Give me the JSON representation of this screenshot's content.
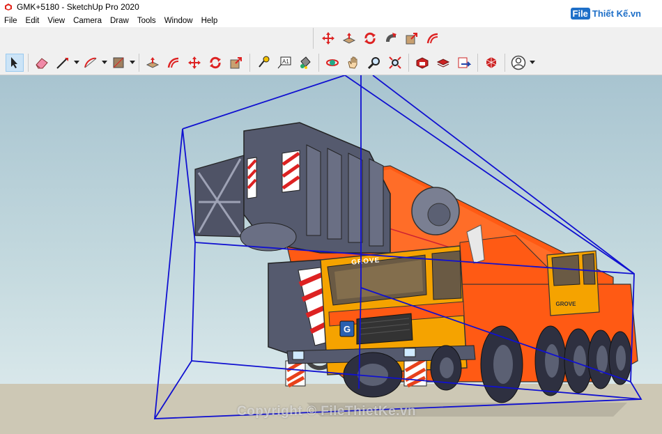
{
  "window": {
    "title": "GMK+5180 - SketchUp Pro 2020"
  },
  "menu": [
    "File",
    "Edit",
    "View",
    "Camera",
    "Draw",
    "Tools",
    "Window",
    "Help"
  ],
  "brand": {
    "prefix": "File",
    "rest": "Thiết Kế.vn"
  },
  "model": {
    "brand_label": "GROVE",
    "badge_letter": "G"
  },
  "watermark": "Copyright © FileThietKe.vn",
  "toolbar_top": [
    "move-icon",
    "push-pull-icon",
    "rotate-icon",
    "follow-me-icon",
    "scale-icon",
    "offset-icon"
  ],
  "toolbar_main": [
    "select-icon",
    "eraser-icon",
    "line-icon",
    "arc-icon",
    "rectangle-icon",
    "push-pull-icon",
    "offset-icon",
    "move-icon",
    "rotate-icon",
    "scale-icon",
    "tape-measure-icon",
    "text-icon",
    "paint-bucket-icon",
    "orbit-icon",
    "pan-icon",
    "zoom-icon",
    "zoom-extents-icon",
    "3d-warehouse-icon",
    "extension-warehouse-icon",
    "layout-icon",
    "extension-manager-icon",
    "user-account-icon"
  ],
  "colors": {
    "bbox": "#1010d0",
    "cab": "#f5a300",
    "body": "#ff5a14",
    "sky_top": "#a8c4d0",
    "ground": "#cdc8b5"
  }
}
